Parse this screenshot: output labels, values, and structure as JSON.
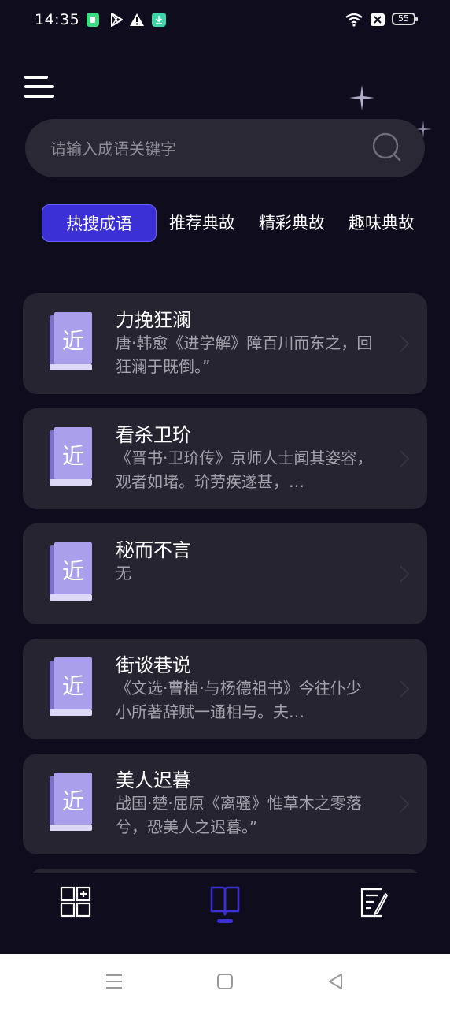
{
  "status_bar": {
    "time": "14:35",
    "battery": "55",
    "icons": [
      "app-notification-icon",
      "play-store-icon",
      "warning-icon",
      "download-icon",
      "wifi-icon",
      "no-sim-icon",
      "battery-icon"
    ]
  },
  "search": {
    "placeholder": "请输入成语关键字"
  },
  "tabs": [
    {
      "label": "热搜成语",
      "active": true
    },
    {
      "label": "推荐典故",
      "active": false
    },
    {
      "label": "精彩典故",
      "active": false
    },
    {
      "label": "趣味典故",
      "active": false
    }
  ],
  "cards": [
    {
      "badge": "近",
      "title": "力挽狂澜",
      "desc": "唐·韩愈《进学解》障百川而东之，回狂澜于既倒。”"
    },
    {
      "badge": "近",
      "title": "看杀卫玠",
      "desc": "《晋书·卫玠传》京师人士闻其姿容，观者如堵。玠劳疾遂甚，…"
    },
    {
      "badge": "近",
      "title": "秘而不言",
      "desc": "无"
    },
    {
      "badge": "近",
      "title": "街谈巷说",
      "desc": "《文选·曹植·与杨德祖书》今往仆少小所著辞赋一通相与。夫…"
    },
    {
      "badge": "近",
      "title": "美人迟暮",
      "desc": "战国·楚·屈原《离骚》惟草木之零落兮，恐美人之迟暮。”"
    }
  ],
  "bottom_nav": [
    {
      "icon": "grid-add-icon",
      "active": false
    },
    {
      "icon": "book-icon",
      "active": true
    },
    {
      "icon": "edit-note-icon",
      "active": false
    }
  ],
  "colors": {
    "background": "#0f0d1d",
    "card": "#262430",
    "accent": "#3b2fd6",
    "book": "#a99fea"
  }
}
